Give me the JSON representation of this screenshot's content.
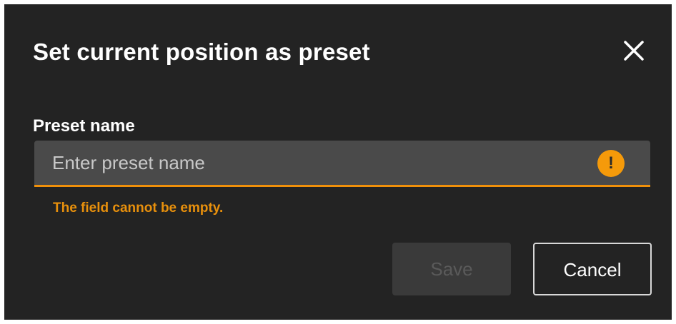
{
  "dialog": {
    "title": "Set current position as preset",
    "close_icon": "close-icon"
  },
  "form": {
    "label": "Preset name",
    "input_value": "",
    "input_placeholder": "Enter preset name",
    "warning_icon": "exclamation-icon",
    "warning_glyph": "!",
    "error_message": "The field cannot be empty."
  },
  "actions": {
    "save_label": "Save",
    "save_enabled": false,
    "cancel_label": "Cancel"
  },
  "colors": {
    "background": "#232323",
    "accent_warning": "#f59a0a",
    "error_text": "#e8900c",
    "input_background": "#4a4a4a"
  }
}
